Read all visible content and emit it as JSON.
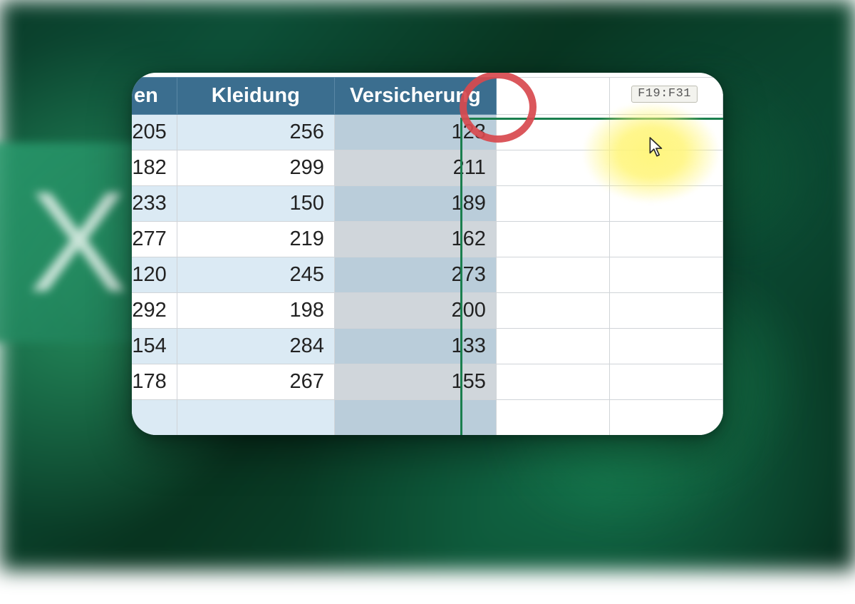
{
  "range_tooltip": "F19:F31",
  "headers": {
    "col_a_fragment": "en",
    "col_b": "Kleidung",
    "col_c": "Versicherung"
  },
  "rows": [
    {
      "a": "205",
      "b": "256",
      "c": "123"
    },
    {
      "a": "182",
      "b": "299",
      "c": "211"
    },
    {
      "a": "233",
      "b": "150",
      "c": "189"
    },
    {
      "a": "277",
      "b": "219",
      "c": "162"
    },
    {
      "a": "120",
      "b": "245",
      "c": "273"
    },
    {
      "a": "292",
      "b": "198",
      "c": "200"
    },
    {
      "a": "154",
      "b": "284",
      "c": "133"
    },
    {
      "a": "178",
      "b": "267",
      "c": "155"
    }
  ],
  "colors": {
    "header_bg": "#3b6e8f",
    "band_bg": "#dbeaf4",
    "selection_border": "#1a7f4e",
    "annotation_red": "#d8494e",
    "highlight_yellow": "#fff578"
  }
}
